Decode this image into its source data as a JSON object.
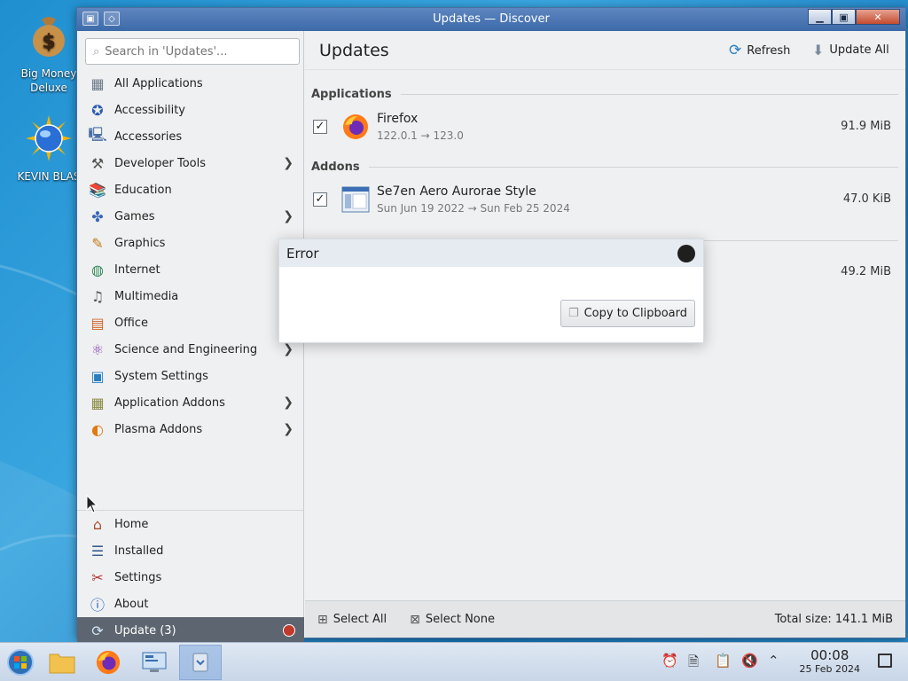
{
  "desktop": {
    "icons": [
      {
        "label_line1": "Big Money",
        "label_line2": "Deluxe"
      },
      {
        "label_line1": "KEVIN BLAS",
        "label_line2": ""
      }
    ]
  },
  "window": {
    "title": "Updates — Discover"
  },
  "sidebar": {
    "search_placeholder": "Search in 'Updates'...",
    "categories": [
      {
        "label": "All Applications",
        "icon": "grid-icon",
        "submenu": false
      },
      {
        "label": "Accessibility",
        "icon": "accessibility-icon",
        "submenu": false
      },
      {
        "label": "Accessories",
        "icon": "accessories-icon",
        "submenu": false
      },
      {
        "label": "Developer Tools",
        "icon": "developer-tools-icon",
        "submenu": true
      },
      {
        "label": "Education",
        "icon": "education-icon",
        "submenu": false
      },
      {
        "label": "Games",
        "icon": "games-icon",
        "submenu": true
      },
      {
        "label": "Graphics",
        "icon": "graphics-icon",
        "submenu": true
      },
      {
        "label": "Internet",
        "icon": "internet-icon",
        "submenu": false
      },
      {
        "label": "Multimedia",
        "icon": "multimedia-icon",
        "submenu": false
      },
      {
        "label": "Office",
        "icon": "office-icon",
        "submenu": false
      },
      {
        "label": "Science and Engineering",
        "icon": "science-icon",
        "submenu": true
      },
      {
        "label": "System Settings",
        "icon": "system-settings-icon",
        "submenu": false
      },
      {
        "label": "Application Addons",
        "icon": "application-addons-icon",
        "submenu": true
      },
      {
        "label": "Plasma Addons",
        "icon": "plasma-addons-icon",
        "submenu": true
      }
    ],
    "bottom": [
      {
        "label": "Home",
        "icon": "home-icon"
      },
      {
        "label": "Installed",
        "icon": "installed-icon"
      },
      {
        "label": "Settings",
        "icon": "settings-icon"
      },
      {
        "label": "About",
        "icon": "about-icon"
      }
    ],
    "update_label": "Update (3)"
  },
  "main": {
    "title": "Updates",
    "refresh_label": "Refresh",
    "update_all_label": "Update All",
    "sections": [
      {
        "heading": "Applications"
      },
      {
        "heading": "Addons"
      }
    ],
    "updates": [
      {
        "name": "Firefox",
        "version": "122.0.1 → 123.0",
        "size": "91.9 MiB",
        "checked": true
      },
      {
        "name": "Se7en Aero Aurorae Style",
        "version": "Sun Jun 19 2022 → Sun Feb 25 2024",
        "size": "47.0 KiB",
        "checked": true
      },
      {
        "name": "",
        "version": "",
        "size": "49.2 MiB",
        "checked": true
      }
    ],
    "select_all_label": "Select All",
    "select_none_label": "Select None",
    "total_size": "Total size: 141.1 MiB"
  },
  "error_dialog": {
    "title": "Error",
    "copy_label": "Copy to Clipboard"
  },
  "taskbar": {
    "time": "00:08",
    "date": "25 Feb 2024"
  }
}
